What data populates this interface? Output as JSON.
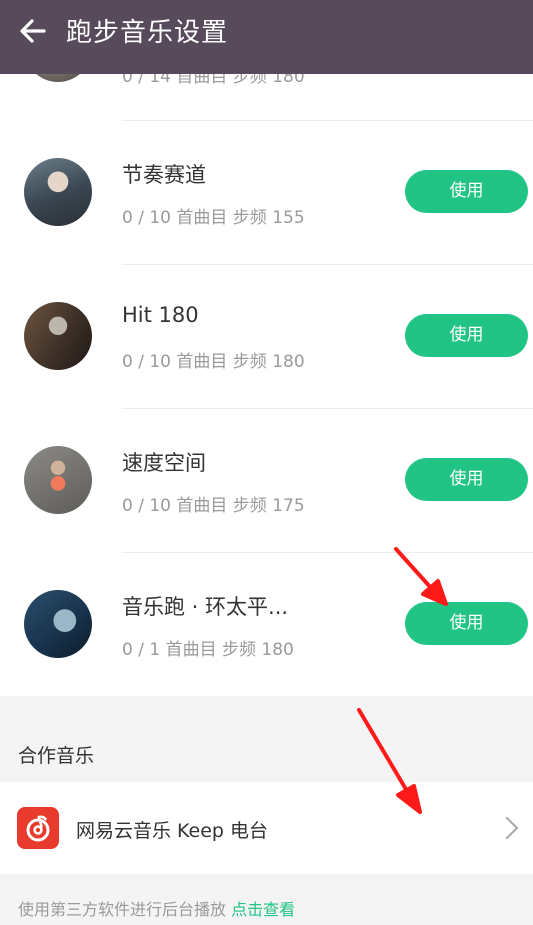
{
  "header": {
    "title": "跑步音乐设置",
    "back_icon": "arrow-left-icon"
  },
  "partial_item": {
    "subtitle": "0 / 14 首曲目 步频 180"
  },
  "playlists": [
    {
      "title": "节奏赛道",
      "subtitle": "0 / 10 首曲目 步频 155",
      "button": "使用"
    },
    {
      "title": "Hit 180",
      "subtitle": "0 / 10 首曲目 步频 180",
      "button": "使用"
    },
    {
      "title": "速度空间",
      "subtitle": "0 / 10 首曲目 步频 175",
      "button": "使用"
    },
    {
      "title": "音乐跑 · 环太平...",
      "subtitle": "0 / 1 首曲目 步频 180",
      "button": "使用"
    }
  ],
  "partner_section": {
    "label": "合作音乐",
    "item_label": "网易云音乐 Keep 电台",
    "item_icon": "netease-music-icon"
  },
  "footer_note": {
    "text": "使用第三方软件进行后台播放 ",
    "link": "点击查看"
  },
  "colors": {
    "header_bg": "#564a5b",
    "accent_green": "#21c485",
    "netease_red": "#e83a2d",
    "annotation_red": "#ff1a1a"
  }
}
